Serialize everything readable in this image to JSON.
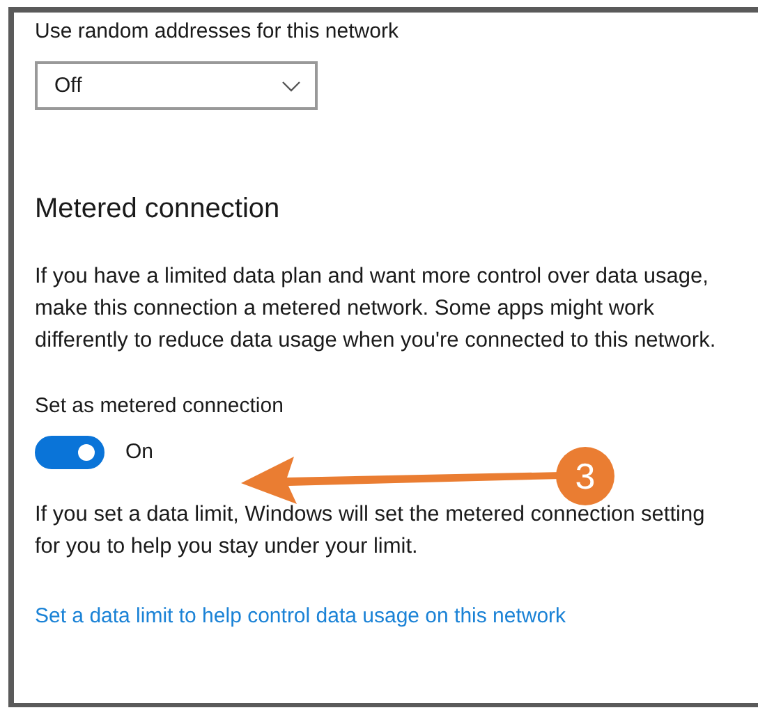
{
  "random_addresses": {
    "label": "Use random addresses for this network",
    "dropdown": {
      "value": "Off"
    }
  },
  "metered": {
    "heading": "Metered connection",
    "description": "If you have a limited data plan and want more control over data usage, make this connection a metered network. Some apps might work differently to reduce data usage when you're connected to this network.",
    "toggle_label": "Set as metered connection",
    "toggle": {
      "on": true,
      "state_text": "On"
    },
    "note": "If you set a data limit, Windows will set the metered connection setting for you to help you stay under your limit.",
    "link": "Set a data limit to help control data usage on this network"
  },
  "callout": {
    "number": "3"
  }
}
